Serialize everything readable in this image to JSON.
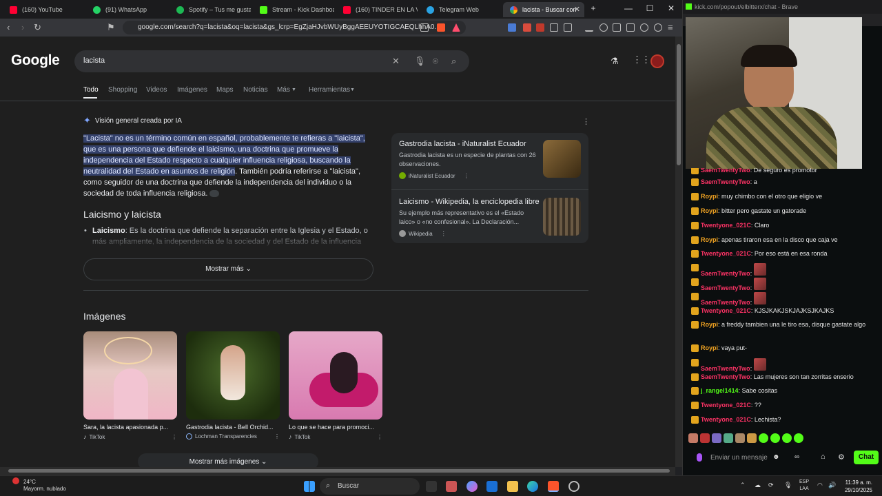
{
  "browser": {
    "tabs": [
      {
        "label": "(160) YouTube",
        "color": "#ff0033"
      },
      {
        "label": "(91) WhatsApp",
        "color": "#25d366"
      },
      {
        "label": "Spotify – Tus me gusta",
        "color": "#1db954"
      },
      {
        "label": "Stream - Kick Dashboard",
        "color": "#53fc18"
      },
      {
        "label": "(160) TINDER EN LA VIDA",
        "color": "#ff0033"
      },
      {
        "label": "Telegram Web",
        "color": "#2aa3e3"
      },
      {
        "label": "lacista - Buscar con",
        "color": "#ffffff"
      }
    ],
    "url": "google.com/search?q=lacista&oq=lacista&gs_lcrp=EgZjaHJvbWUyBggAEEUYOTIGCAEQLhhA0..."
  },
  "google": {
    "logo": "Google",
    "query": "lacista",
    "tabs": [
      "Todo",
      "Shopping",
      "Videos",
      "Imágenes",
      "Maps",
      "Noticias",
      "Más",
      "Herramientas"
    ],
    "ai": {
      "title": "Visión general creada por IA",
      "highlight": "\"Lacista\" no es un término común en español, probablemente te refieras a \"laicista\", que es una persona que defiende el laicismo, una doctrina que promueve la independencia del Estado respecto a cualquier influencia religiosa, buscando la neutralidad del Estado en asuntos de religión",
      "rest": ". También podría referirse a \"laicista\", como seguidor de una doctrina que defiende la independencia del individuo o la sociedad de toda influencia religiosa.",
      "subheading": "Laicismo y laicista",
      "bullet_term": "Laicismo",
      "bullet_text": ": Es la doctrina que defiende la separación entre la Iglesia y el Estado, o más ampliamente, la independencia de la sociedad y del Estado de la influencia",
      "show_more": "Mostrar más"
    },
    "sources": [
      {
        "title": "Gastrodia lacista - iNaturalist Ecuador",
        "desc": "Gastrodia lacista es un especie de plantas con 26 observaciones.",
        "site": "iNaturalist Ecuador"
      },
      {
        "title": "Laicismo - Wikipedia, la enciclopedia libre",
        "desc": "Su ejemplo más representativo es el «Estado laico» o «no confesional». La Declaración...",
        "site": "Wikipedia"
      }
    ],
    "images": {
      "heading": "Imágenes",
      "cards": [
        {
          "caption": "Sara, la lacista apasionada p...",
          "site": "TikTok"
        },
        {
          "caption": "Gastrodia lacista - Bell Orchid...",
          "site": "Lochman Transparencies"
        },
        {
          "caption": "Lo que se hace para promoci...",
          "site": "TikTok"
        }
      ],
      "more": "Mostrar más imágenes"
    }
  },
  "kick": {
    "window_title": "kick.com/popout/elbitterx/chat - Brave",
    "messages": [
      {
        "user": "SaemTwentyTwo",
        "color": "#ff3366",
        "text": "De seguro es promotor"
      },
      {
        "user": "SaemTwentyTwo",
        "color": "#ff3366",
        "text": "a"
      },
      {
        "user": "Roypi",
        "color": "#f5a623",
        "text": "muy chimbo con el otro que eligio ve"
      },
      {
        "user": "Roypi",
        "color": "#f5a623",
        "text": "bitter pero gastate un gatorade"
      },
      {
        "user": "Twentyone_021C",
        "color": "#ff3366",
        "text": "Claro"
      },
      {
        "user": "Roypi",
        "color": "#f5a623",
        "text": "apenas tiraron esa en la disco que caja ve"
      },
      {
        "user": "Twentyone_021C",
        "color": "#ff3366",
        "text": "Por eso está en esa ronda"
      },
      {
        "user": "SaemTwentyTwo",
        "color": "#ff3366",
        "text": ""
      },
      {
        "user": "SaemTwentyTwo",
        "color": "#ff3366",
        "text": ""
      },
      {
        "user": "SaemTwentyTwo",
        "color": "#ff3366",
        "text": ""
      },
      {
        "user": "Twentyone_021C",
        "color": "#ff3366",
        "text": "KJSJKAKJSKJAJKSJKAJKS"
      },
      {
        "user": "Roypi",
        "color": "#f5a623",
        "text": "a freddy tambien una le tiro esa, disque gastate algo"
      },
      {
        "user": "Roypi",
        "color": "#f5a623",
        "text": "vaya put-"
      },
      {
        "user": "SaemTwentyTwo",
        "color": "#ff3366",
        "text": ""
      },
      {
        "user": "SaemTwentyTwo",
        "color": "#ff3366",
        "text": "Las mujeres son tan zorritas enserio"
      },
      {
        "user": "j_rangel1414",
        "color": "#53fc18",
        "text": "Sabe cositas"
      },
      {
        "user": "Twentyone_021C",
        "color": "#ff3366",
        "text": "??"
      },
      {
        "user": "Twentyone_021C",
        "color": "#ff3366",
        "text": "Lechista?"
      }
    ],
    "input_placeholder": "Enviar un mensaje",
    "chat_button": "Chat"
  },
  "taskbar": {
    "temp": "24°C",
    "weather": "Mayorm. nublado",
    "search": "Buscar",
    "lang1": "ESP",
    "lang2": "LAA",
    "time": "11:39 a. m.",
    "date": "29/10/2025"
  }
}
